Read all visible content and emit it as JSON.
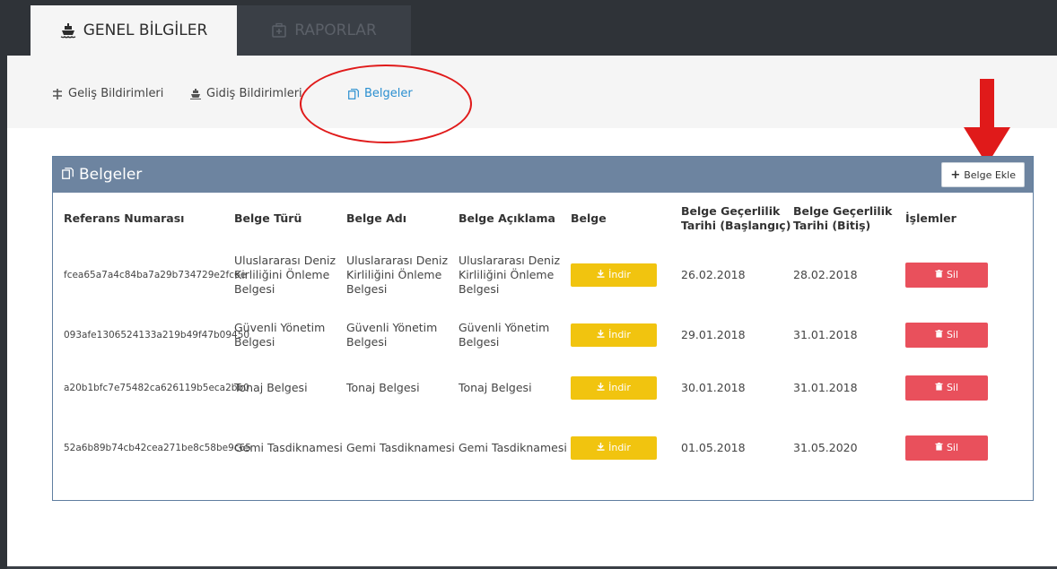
{
  "tabs": [
    {
      "label": "GENEL BİLGİLER",
      "icon": "ship-icon",
      "active": true
    },
    {
      "label": "RAPORLAR",
      "icon": "medical-kit-icon",
      "active": false
    }
  ],
  "subnav": [
    {
      "label": "Geliş Bildirimleri",
      "icon": "anchor-icon",
      "active": false
    },
    {
      "label": "Gidiş Bildirimleri",
      "icon": "ship-icon",
      "active": false
    },
    {
      "label": "Belgeler",
      "icon": "documents-icon",
      "active": true
    }
  ],
  "panel": {
    "title": "Belgeler",
    "add_label": "Belge Ekle"
  },
  "table": {
    "headers": [
      "Referans Numarası",
      "Belge Türü",
      "Belge Adı",
      "Belge Açıklama",
      "Belge",
      "Belge Geçerlilik Tarihi (Başlangıç)",
      "Belge Geçerlilik Tarihi (Bitiş)",
      "İşlemler"
    ],
    "rows": [
      {
        "ref": "fcea65a7a4c84ba7a29b734729e2fc6e",
        "type": "Uluslararası Deniz Kirliliğini Önleme Belgesi",
        "name": "Uluslararası Deniz Kirliliğini Önleme Belgesi",
        "desc": "Uluslararası Deniz Kirliliğini Önleme Belgesi",
        "download": "İndir",
        "start": "26.02.2018",
        "end": "28.02.2018",
        "delete": "Sil"
      },
      {
        "ref": "093afe1306524133a219b49f47b09450",
        "type": "Güvenli Yönetim Belgesi",
        "name": "Güvenli Yönetim Belgesi",
        "desc": "Güvenli Yönetim Belgesi",
        "download": "İndir",
        "start": "29.01.2018",
        "end": "31.01.2018",
        "delete": "Sil"
      },
      {
        "ref": "a20b1bfc7e75482ca626119b5eca2bb0",
        "type": "Tonaj Belgesi",
        "name": "Tonaj Belgesi",
        "desc": "Tonaj Belgesi",
        "download": "İndir",
        "start": "30.01.2018",
        "end": "31.01.2018",
        "delete": "Sil"
      },
      {
        "ref": "52a6b89b74cb42cea271be8c58be9c65",
        "type": "Gemi Tasdiknamesi",
        "name": "Gemi Tasdiknamesi",
        "desc": "Gemi Tasdiknamesi",
        "download": "İndir",
        "start": "01.05.2018",
        "end": "31.05.2020",
        "delete": "Sil"
      }
    ]
  },
  "colors": {
    "topbar": "#2f3338",
    "header_panel": "#6d84a0",
    "download_button": "#f1c40f",
    "delete_button": "#e9505c",
    "active_link": "#2a8fd0",
    "annotation": "#e01a1a"
  }
}
